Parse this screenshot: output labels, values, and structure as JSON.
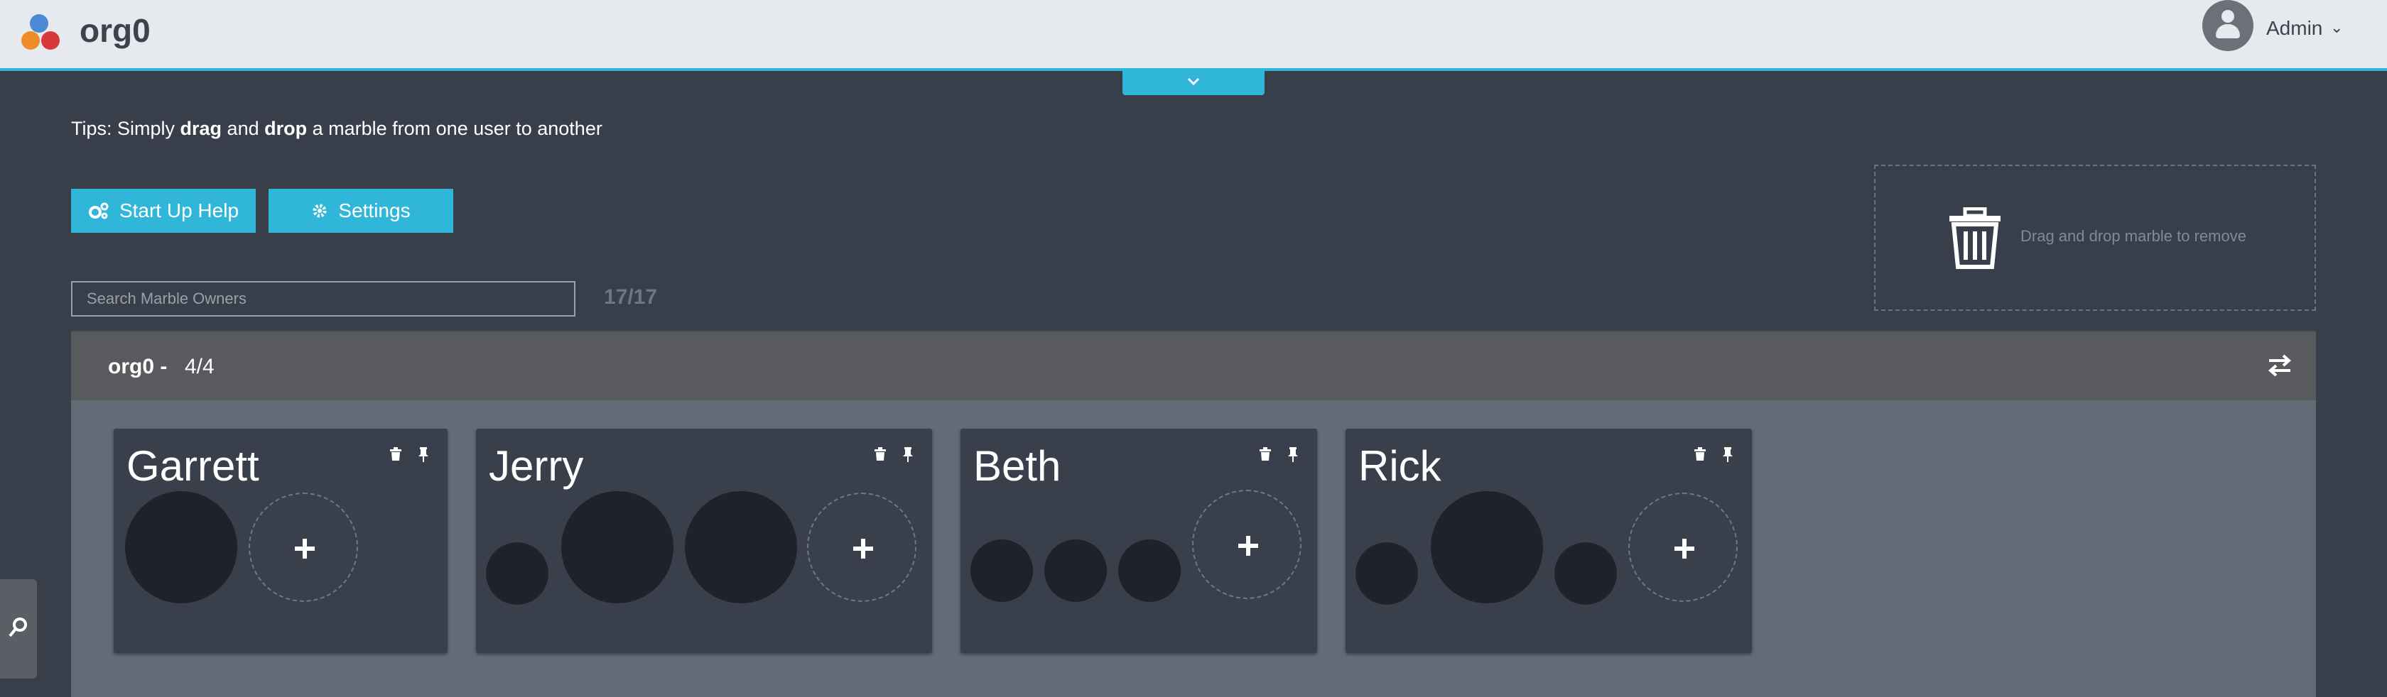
{
  "header": {
    "brand": "org0",
    "user": "Admin"
  },
  "tips": {
    "prefix": "Tips: Simply ",
    "drag": "drag",
    "and": " and ",
    "drop": "drop",
    "suffix": " a marble from one user to another"
  },
  "buttons": {
    "help": "Start Up Help",
    "settings": "Settings"
  },
  "search": {
    "placeholder": "Search Marble Owners",
    "count": "17/17"
  },
  "trash": {
    "text": "Drag and drop marble to remove"
  },
  "org": {
    "name": "org0 -",
    "count": "4/4"
  },
  "owners": [
    {
      "name": "Garrett",
      "marbles": [
        "large"
      ]
    },
    {
      "name": "Jerry",
      "marbles": [
        "small",
        "large",
        "large"
      ]
    },
    {
      "name": "Beth",
      "marbles": [
        "small",
        "small",
        "small"
      ]
    },
    {
      "name": "Rick",
      "marbles": [
        "small",
        "large",
        "small"
      ]
    }
  ],
  "colors": {
    "accent": "#30b6d8",
    "marble": "#1f2228"
  }
}
